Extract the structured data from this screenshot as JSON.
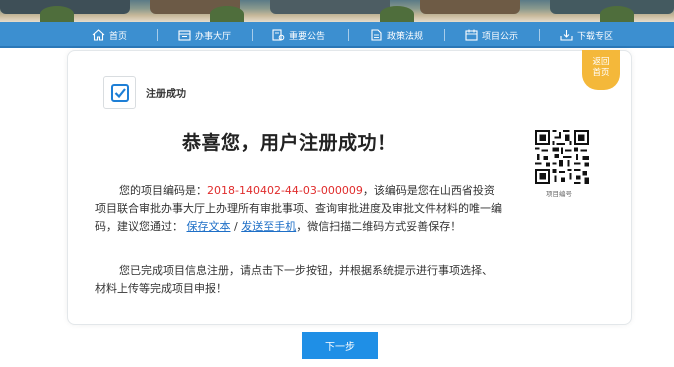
{
  "nav": {
    "items": [
      {
        "label": "首页",
        "icon": "home-icon"
      },
      {
        "label": "办事大厅",
        "icon": "hall-icon"
      },
      {
        "label": "重要公告",
        "icon": "announcement-icon"
      },
      {
        "label": "政策法规",
        "icon": "policy-document-icon"
      },
      {
        "label": "项目公示",
        "icon": "calendar-icon"
      },
      {
        "label": "下载专区",
        "icon": "download-icon"
      }
    ]
  },
  "success": {
    "label": "注册成功",
    "headline": "恭喜您，用户注册成功！"
  },
  "return_tab": {
    "line1": "返回",
    "line2": "首页"
  },
  "qr": {
    "caption": "项目编号"
  },
  "message": {
    "p1_prefix": "您的项目编码是：",
    "project_code": "2018-140402-44-03-000009",
    "p1_middle": "，该编码是您在山西省投资项目联合审批办事大厅上办理所有审批事项、查询审批进度及审批文件材料的唯一编码，建议您通过：",
    "save_text_link": "保存文本",
    "separator": "/",
    "send_phone_link": "发送至手机",
    "p1_suffix": "，微信扫描二维码方式妥善保存！",
    "p2": "您已完成项目信息注册，请点击下一步按钮，并根据系统提示进行事项选择、材料上传等完成项目申报！"
  },
  "next_button": {
    "label": "下一步"
  },
  "colors": {
    "nav_blue": "#3c8fd0",
    "code_red": "#e02c2c",
    "link_blue": "#1e6fc7",
    "return_orange": "#f4b83a",
    "button_blue": "#1f8fe6"
  }
}
